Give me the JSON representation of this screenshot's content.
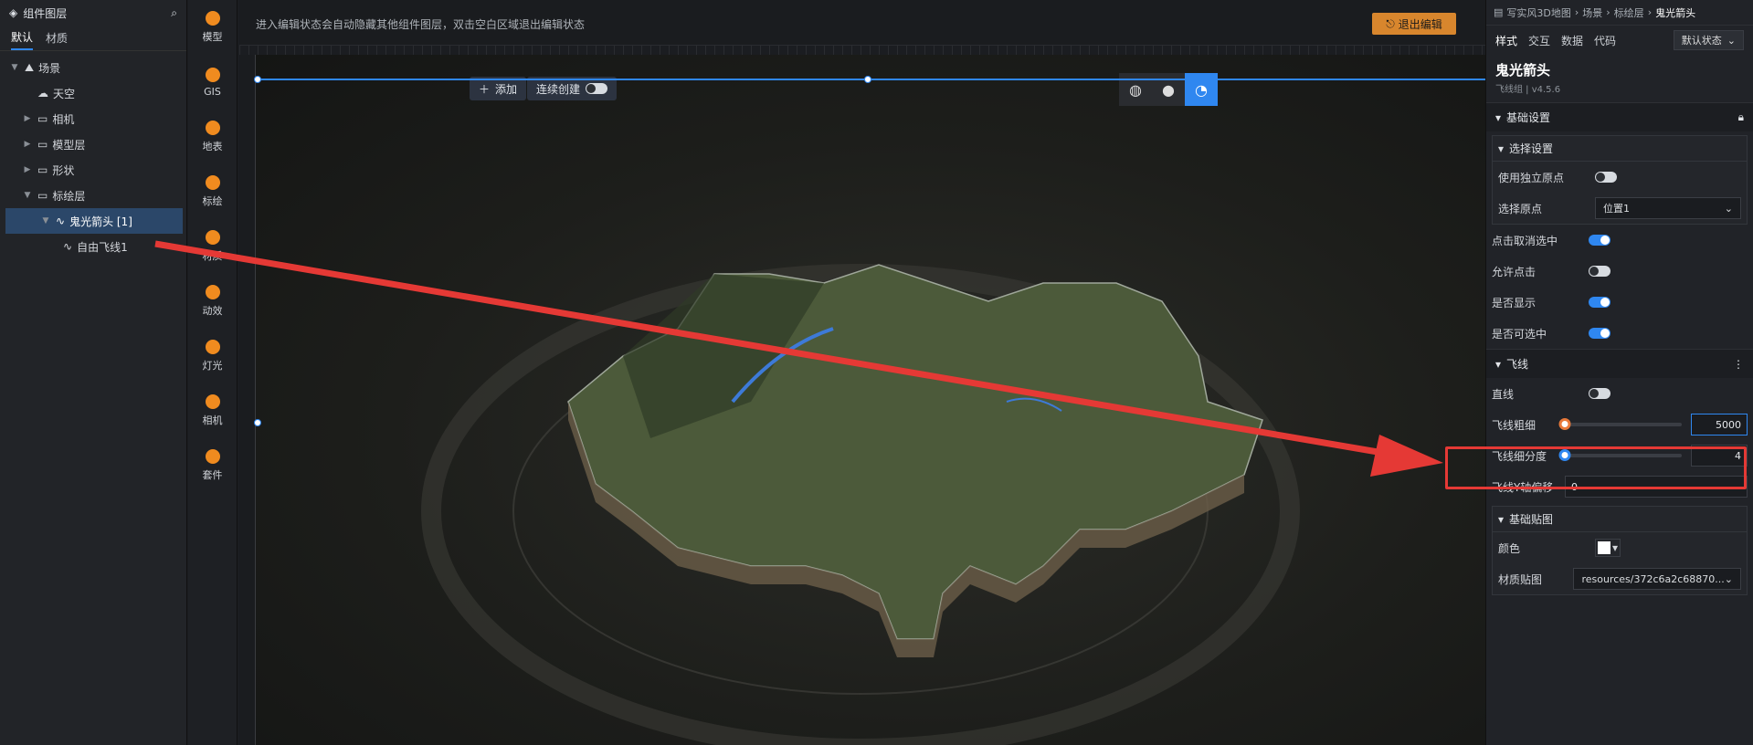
{
  "layers_panel": {
    "title": "组件图层",
    "tabs": [
      "默认",
      "材质"
    ],
    "active_tab": "默认",
    "tree": [
      {
        "label": "场景",
        "depth": 0,
        "caret": "▼",
        "icon": "scene-icon"
      },
      {
        "label": "天空",
        "depth": 1,
        "caret": "",
        "icon": "sky-icon"
      },
      {
        "label": "相机",
        "depth": 1,
        "caret": "▶",
        "icon": "folder-icon"
      },
      {
        "label": "模型层",
        "depth": 1,
        "caret": "▶",
        "icon": "folder-icon"
      },
      {
        "label": "形状",
        "depth": 1,
        "caret": "▶",
        "icon": "folder-icon"
      },
      {
        "label": "标绘层",
        "depth": 1,
        "caret": "▼",
        "icon": "folder-icon"
      },
      {
        "label": "鬼光箭头 [1]",
        "depth": 2,
        "caret": "▼",
        "icon": "flyline-icon",
        "selected": true
      },
      {
        "label": "自由飞线1",
        "depth": 3,
        "caret": "",
        "icon": "flyline-icon"
      }
    ]
  },
  "toolbar": [
    {
      "label": "模型",
      "icon": "model-icon"
    },
    {
      "label": "GIS",
      "icon": "gis-icon"
    },
    {
      "label": "地表",
      "icon": "terrain-icon"
    },
    {
      "label": "标绘",
      "icon": "marker-icon"
    },
    {
      "label": "材质",
      "icon": "material-icon"
    },
    {
      "label": "动效",
      "icon": "effect-icon"
    },
    {
      "label": "灯光",
      "icon": "light-icon"
    },
    {
      "label": "相机",
      "icon": "camera-icon"
    },
    {
      "label": "套件",
      "icon": "kit-icon"
    }
  ],
  "notice": {
    "text": "进入编辑状态会自动隐藏其他组件图层，双击空白区域退出编辑状态",
    "exit_label": "退出编辑"
  },
  "canvas": {
    "add_label": "添加",
    "continuous_label": "连续创建",
    "continuous_on": false
  },
  "props": {
    "breadcrumb": [
      "写实风3D地图",
      "场景",
      "标绘层",
      "鬼光箭头"
    ],
    "tabs": [
      "样式",
      "交互",
      "数据",
      "代码"
    ],
    "active_tab": "样式",
    "state_label": "默认状态",
    "title": "鬼光箭头",
    "version": "飞线组 | v4.5.6",
    "basic_section": "基础设置",
    "select_group": "选择设置",
    "use_origin_label": "使用独立原点",
    "use_origin_on": false,
    "origin_label": "选择原点",
    "origin_value": "位置1",
    "toggles": [
      {
        "label": "点击取消选中",
        "on": true
      },
      {
        "label": "允许点击",
        "on": false
      },
      {
        "label": "是否显示",
        "on": true
      },
      {
        "label": "是否可选中",
        "on": true
      }
    ],
    "flyline_section": "飞线",
    "straight_label": "直线",
    "straight_on": false,
    "width_label": "飞线粗细",
    "width_value": "5000",
    "width_fraction": 0.0,
    "segments_label": "飞线细分度",
    "segments_value": "4",
    "segments_fraction": 0.0,
    "yoffset_label": "飞线Y轴偏移",
    "yoffset_value": "0",
    "texture_group": "基础贴图",
    "color_label": "颜色",
    "color_value": "#ffffff",
    "texmap_label": "材质贴图",
    "texmap_value": "resources/372c6a2c68870..."
  }
}
